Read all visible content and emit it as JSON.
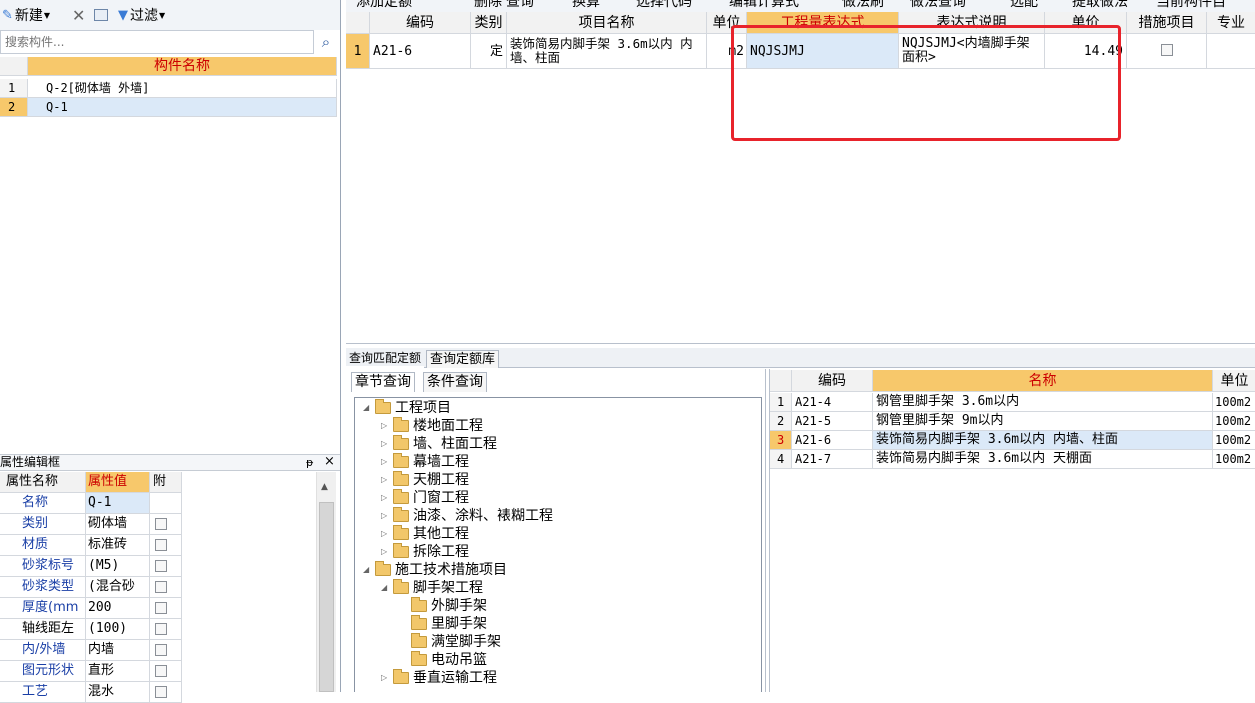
{
  "left_toolbar": {
    "new_label": "新建",
    "delete_icon": "close-icon",
    "copy_icon": "copy-icon",
    "filter_label": "过滤"
  },
  "search": {
    "placeholder": "搜索构件..."
  },
  "component_list": {
    "header": "构件名称",
    "rows": [
      {
        "no": "1",
        "name": "Q-2[砌体墙 外墙]"
      },
      {
        "no": "2",
        "name": "Q-1"
      }
    ]
  },
  "property_panel": {
    "title": "属性编辑框",
    "pin": "ᵽ",
    "close": "×",
    "headers": [
      "属性名称",
      "属性值",
      "附"
    ],
    "rows": [
      {
        "name": "名称",
        "value": "Q-1",
        "check": false
      },
      {
        "name": "类别",
        "value": "砌体墙",
        "check": true
      },
      {
        "name": "材质",
        "value": "标准砖",
        "check": true
      },
      {
        "name": "砂浆标号",
        "value": "(M5)",
        "check": true
      },
      {
        "name": "砂浆类型",
        "value": "(混合砂",
        "check": true
      },
      {
        "name": "厚度(mm",
        "value": "200",
        "check": true
      },
      {
        "name": "轴线距左",
        "value": "(100)",
        "check": true
      },
      {
        "name": "内/外墙",
        "value": "内墙",
        "check": true
      },
      {
        "name": "图元形状",
        "value": "直形",
        "check": true
      },
      {
        "name": "工艺",
        "value": "混水",
        "check": true
      }
    ]
  },
  "main_toolbar": {
    "items": [
      "添加定额",
      "删除",
      "查询",
      "换算",
      "选择代码",
      "编辑计算式",
      "做法刷",
      "做法查询",
      "选配",
      "提取做法",
      "当前构件自"
    ]
  },
  "main_grid": {
    "headers": [
      "编码",
      "类别",
      "项目名称",
      "单位",
      "工程量表达式",
      "表达式说明",
      "单价",
      "措施项目",
      "专业"
    ],
    "rows": [
      {
        "no": "1",
        "code": "A21-6",
        "type": "定",
        "name": "装饰简易内脚手架 3.6m以内 内墙、柱面",
        "unit": "m2",
        "expr": "NQJSJMJ",
        "expr_desc": "NQJSJMJ<内墙脚手架面积>",
        "price": "14.49",
        "measure": false
      }
    ]
  },
  "bottom_tabs": [
    "查询匹配定额",
    "查询定额库"
  ],
  "query_tabs": [
    "章节查询",
    "条件查询"
  ],
  "tree": [
    {
      "label": "工程项目",
      "level": 0,
      "expanded": true
    },
    {
      "label": "楼地面工程",
      "level": 1,
      "expanded": false
    },
    {
      "label": "墙、柱面工程",
      "level": 1,
      "expanded": false
    },
    {
      "label": "幕墙工程",
      "level": 1,
      "expanded": false
    },
    {
      "label": "天棚工程",
      "level": 1,
      "expanded": false
    },
    {
      "label": "门窗工程",
      "level": 1,
      "expanded": false
    },
    {
      "label": "油漆、涂料、裱糊工程",
      "level": 1,
      "expanded": false
    },
    {
      "label": "其他工程",
      "level": 1,
      "expanded": false
    },
    {
      "label": "拆除工程",
      "level": 1,
      "expanded": false
    },
    {
      "label": "施工技术措施项目",
      "level": 0,
      "expanded": true
    },
    {
      "label": "脚手架工程",
      "level": 1,
      "expanded": true
    },
    {
      "label": "外脚手架",
      "level": 2,
      "expanded": null
    },
    {
      "label": "里脚手架",
      "level": 2,
      "expanded": null
    },
    {
      "label": "满堂脚手架",
      "level": 2,
      "expanded": null
    },
    {
      "label": "电动吊篮",
      "level": 2,
      "expanded": null
    },
    {
      "label": "垂直运输工程",
      "level": 1,
      "expanded": false
    }
  ],
  "quota_grid": {
    "headers": [
      "编码",
      "名称",
      "单位"
    ],
    "rows": [
      {
        "no": "1",
        "code": "A21-4",
        "name": "钢管里脚手架 3.6m以内",
        "unit": "100m2"
      },
      {
        "no": "2",
        "code": "A21-5",
        "name": "钢管里脚手架 9m以内",
        "unit": "100m2"
      },
      {
        "no": "3",
        "code": "A21-6",
        "name": "装饰简易内脚手架 3.6m以内 内墙、柱面",
        "unit": "100m2"
      },
      {
        "no": "4",
        "code": "A21-7",
        "name": "装饰简易内脚手架 3.6m以内 天棚面",
        "unit": "100m2"
      }
    ]
  },
  "colors": {
    "header_orange": "#f7c86b",
    "selected_row": "#dbe9f8",
    "highlight_red": "#e8232b",
    "row_num_selected": "#f7c86b"
  }
}
